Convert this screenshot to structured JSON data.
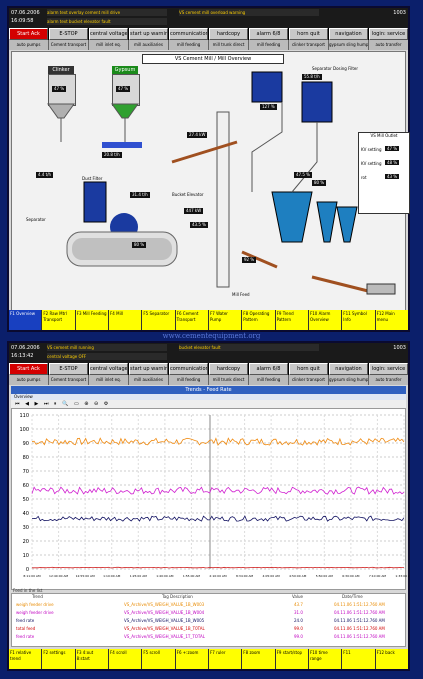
{
  "top": {
    "date": "07.06.2006",
    "time": "16:09:58",
    "alarm1": "alarm text overlay cement mill drive",
    "alarm2": "alarm text bucket elevator fault",
    "alarm3": "VS cement mill overload warning",
    "page_ref": "1003",
    "buttons": [
      "Start Ack",
      "E-STOP",
      "central voltage off",
      "start up warning",
      "communication PC <-> PLS",
      "hardcopy",
      "alarm 6/8",
      "horn quit",
      "navigation",
      "login: service"
    ],
    "subs": [
      "auto pumps",
      "Cement transport",
      "mill inlet eq.",
      "mill auxiliaries",
      "mill feeding",
      "mill trunk direct",
      "mill feeding",
      "clinker transport",
      "gypsum sling hump",
      "auto transfer"
    ],
    "title": "VS Cement Mill / Mill Overview",
    "clinker": "Clinker",
    "gypsum": "Gypsum",
    "clinker_pct": "47 %",
    "gypsum_pct": "47 %",
    "separator_dosing": "Separator Dosing Filter",
    "separator": "Separator",
    "dust_filter": "Dust Filter",
    "bucket_elevator": "Bucket Elevator",
    "mill_feed": "Mill Feed",
    "values": [
      "20.8 t/h",
      "4.4 t/h",
      "31.4 t/h",
      "447 kW",
      "43.5 %",
      "47.5 %",
      "80 %",
      "127 %",
      "55.8 t/h",
      "27.4 kW",
      "80 %",
      "92 %"
    ],
    "side_title": "VS Mill Outlet",
    "side_rows": [
      {
        "label": "KV setting",
        "value": "47 %"
      },
      {
        "label": "KV setting",
        "value": "48 %"
      },
      {
        "label": "rot",
        "value": "43 %"
      }
    ],
    "fkeys": [
      {
        "k": "F1",
        "t": "Overview"
      },
      {
        "k": "F2",
        "t": "Raw Mtrl Transport"
      },
      {
        "k": "F3",
        "t": "Mill Feeding"
      },
      {
        "k": "F4",
        "t": "Mill"
      },
      {
        "k": "F5",
        "t": "Separator"
      },
      {
        "k": "F6",
        "t": "Cement Transport"
      },
      {
        "k": "F7",
        "t": "Water Pump"
      },
      {
        "k": "F8",
        "t": "Operating Pattern"
      },
      {
        "k": "F9",
        "t": "Trend Pattern"
      },
      {
        "k": "F10",
        "t": "Alarm Overview"
      },
      {
        "k": "F11",
        "t": "Symbol Info"
      },
      {
        "k": "F12",
        "t": "Main menu"
      }
    ]
  },
  "bottom": {
    "date": "07.06.2006",
    "time": "16:13:42",
    "alarm1": "VS cement mill running",
    "alarm2": "central voltage OFF",
    "alarm3": "bucket elevator fault",
    "page_ref": "1003",
    "buttons": [
      "Start Ack",
      "E-STOP",
      "central voltage off",
      "start up warning",
      "communication PC <-> PLS",
      "hardcopy",
      "alarm 6/8",
      "horn quit",
      "navigation",
      "login: service"
    ],
    "subs": [
      "auto pumps",
      "Cement transport",
      "mill inlet eq.",
      "mill auxiliaries",
      "mill feeding",
      "mill trunk direct",
      "mill feeding",
      "clinker transport",
      "gypsum sling hump",
      "auto transfer"
    ],
    "trend_title": "Trends - Feed Rate",
    "trend_bar": "Overview",
    "toolbar": "⏮ ◀ ▶ ⏭ ⏸ 🔍 ▭ ⊕ ⊖ ⚙",
    "footer_label": "Feed in the list",
    "table_header": [
      "Trend",
      "Tag Description",
      "Value",
      "Date/Time"
    ],
    "rows": [
      {
        "name": "weigh feeder drive",
        "desc": "VS_Archive/VS_WEIGH_VALUE_1B_W003",
        "val": "43.7",
        "time": "04.11.06 1:51:12.760 AM",
        "color": "#e88a00"
      },
      {
        "name": "weigh feeder drive",
        "desc": "VS_Archive/VS_WEIGH_VALUE_1B_W004",
        "val": "31.0",
        "time": "04.11.06 1:51:12.760 AM",
        "color": "#c000c0"
      },
      {
        "name": "feed rate",
        "desc": "VS_Archive/VS_WEIGH_VALUE_1B_W005",
        "val": "24.0",
        "time": "04.11.06 1:51:12.760 AM",
        "color": "#101060"
      },
      {
        "name": "total feed",
        "desc": "VS_Archive/VS_WEIGH_VALUE_1B_T0TAL",
        "val": "99.0",
        "time": "04.11.06 1:51:12.760 AM",
        "color": "#d00000"
      },
      {
        "name": "feed rate",
        "desc": "VS_Archive/VS_WEIGH_VALUE_1T_TOTAL",
        "val": "99.0",
        "time": "04.11.06 1:51:12.760 AM",
        "color": "#c000c0"
      }
    ],
    "fkeys": [
      {
        "k": "F1",
        "t": "relative trend"
      },
      {
        "k": "F2",
        "t": "settings"
      },
      {
        "k": "F3",
        "t": "4:out 8:start"
      },
      {
        "k": "F4",
        "t": "scroll"
      },
      {
        "k": "F5",
        "t": "scroll"
      },
      {
        "k": "F6",
        "t": "+:zoom"
      },
      {
        "k": "F7",
        "t": "ruler"
      },
      {
        "k": "F8",
        "t": "zoom"
      },
      {
        "k": "F9",
        "t": "start/stop"
      },
      {
        "k": "F10",
        "t": "time range"
      },
      {
        "k": "F11",
        "t": ""
      },
      {
        "k": "F12",
        "t": "back"
      }
    ]
  },
  "watermark": "www.cementequipment.org",
  "chart_data": {
    "type": "line",
    "title": "",
    "xlabel": "",
    "ylabel": "",
    "ylim": [
      0,
      110
    ],
    "y_ticks": [
      0,
      10,
      20,
      30,
      40,
      50,
      60,
      70,
      80,
      90,
      100,
      110
    ],
    "x_ticks": [
      "8:11:00 AM",
      "12:40:00 AM",
      "12:55:00 AM",
      "1:10:00 AM",
      "1:25:00 AM",
      "1:40:00 AM",
      "1:55:00 AM",
      "2:10:00 AM",
      "8:34:00 AM",
      "4:05:00 AM",
      "4:50:00 AM",
      "5:50:00 AM",
      "6:30:00 AM",
      "7:10:00 AM",
      "1:33:00 AM"
    ],
    "series": [
      {
        "name": "weigh feeder drive",
        "color": "#f08a10",
        "mean": 91,
        "noise": 2.5
      },
      {
        "name": "weigh feeder drive",
        "color": "#d020d0",
        "mean": 56,
        "noise": 2.5
      },
      {
        "name": "feed rate",
        "color": "#101060",
        "mean": 36,
        "noise": 1.8
      },
      {
        "name": "total feed",
        "color": "#d02020",
        "mean": 1,
        "noise": 0.2
      }
    ]
  }
}
